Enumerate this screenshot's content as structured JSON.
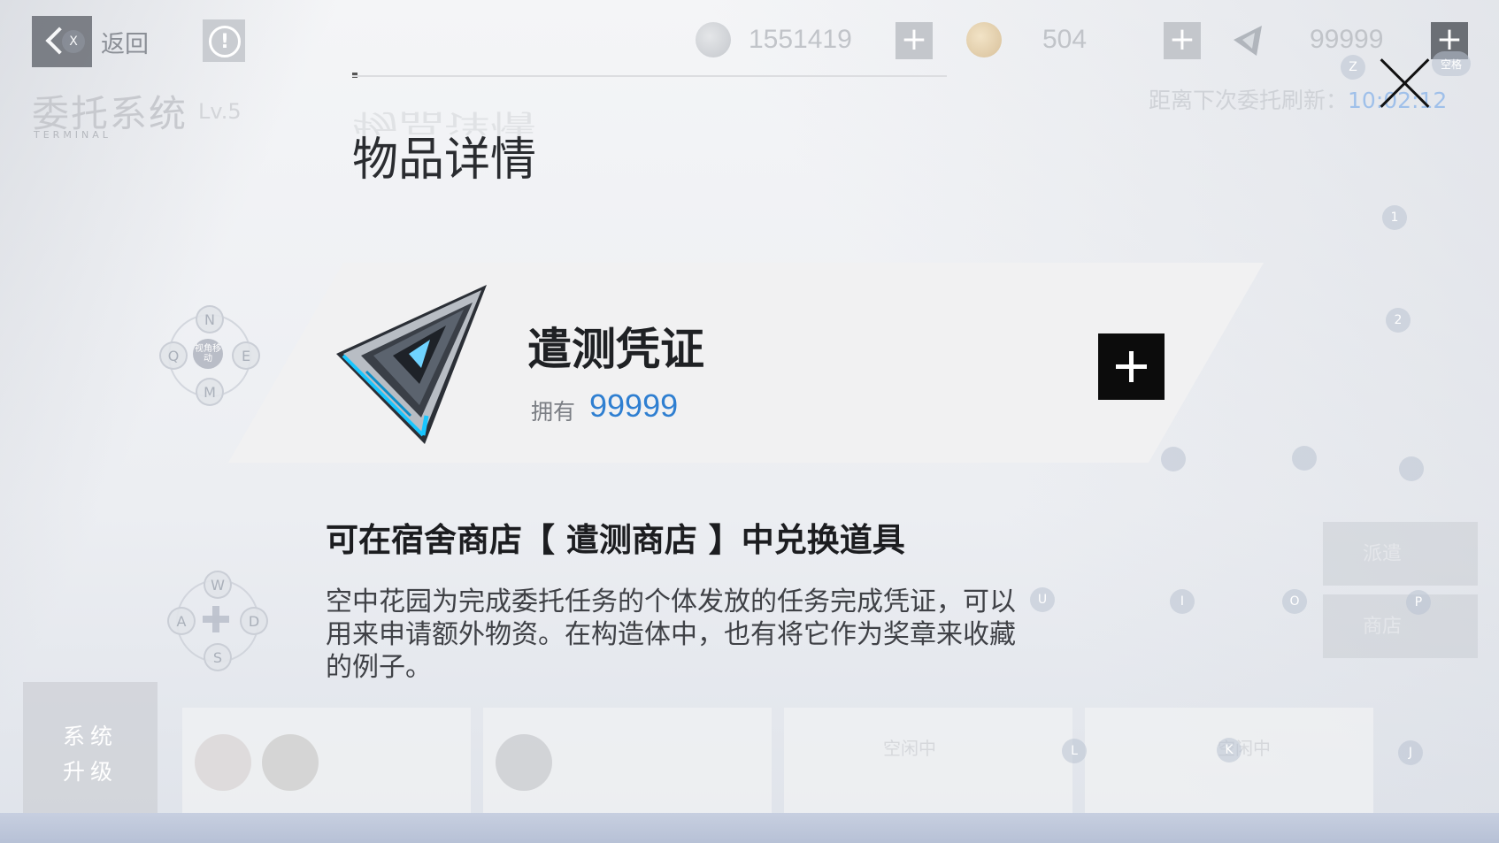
{
  "topbar": {
    "back_label": "返回",
    "back_key": "X",
    "info_symbol": "!",
    "page_title": "委托系统",
    "page_level": "Lv.5",
    "page_subtitle": "TERMINAL",
    "currencies": [
      {
        "icon": "shield-coin-icon",
        "value": "1551419",
        "plus": "+"
      },
      {
        "icon": "gold-coin-icon",
        "value": "504",
        "plus": "+"
      },
      {
        "icon": "triangle-token-icon",
        "value": "99999",
        "plus": "+"
      }
    ],
    "refresh_label": "距离下次委托刷新：",
    "refresh_time": "10:02:12",
    "z_key": "Z",
    "space_key": "空格"
  },
  "modal": {
    "title": "物品详情",
    "item_name": "遣测凭证",
    "own_label": "拥有",
    "own_value": "99999",
    "source_text": "可在宿舍商店【 遣测商店 】中兑换道具",
    "description": "空中花园为完成委托任务的个体发放的任务完成凭证，可以用来申请额外物资。在构造体中，也有将它作为奖章来收藏的例子。"
  },
  "controls": {
    "upper_pad": {
      "top": "N",
      "left": "Q",
      "right": "E",
      "bottom": "M",
      "center": "视角移动"
    },
    "lower_pad": {
      "top": "W",
      "left": "A",
      "right": "D",
      "bottom": "S"
    },
    "keys": [
      "1",
      "2",
      "U",
      "I",
      "O",
      "P",
      "L",
      "K",
      "J"
    ]
  },
  "background": {
    "upgrade_label_1": "系统",
    "upgrade_label_2": "升级",
    "card_label_1": "空闲中",
    "card_label_2": "空闲中",
    "tab_1": "派遣",
    "tab_2": "商店"
  },
  "colors": {
    "accent_blue": "#2f7fd1",
    "add_button": "#0c0c0c"
  }
}
